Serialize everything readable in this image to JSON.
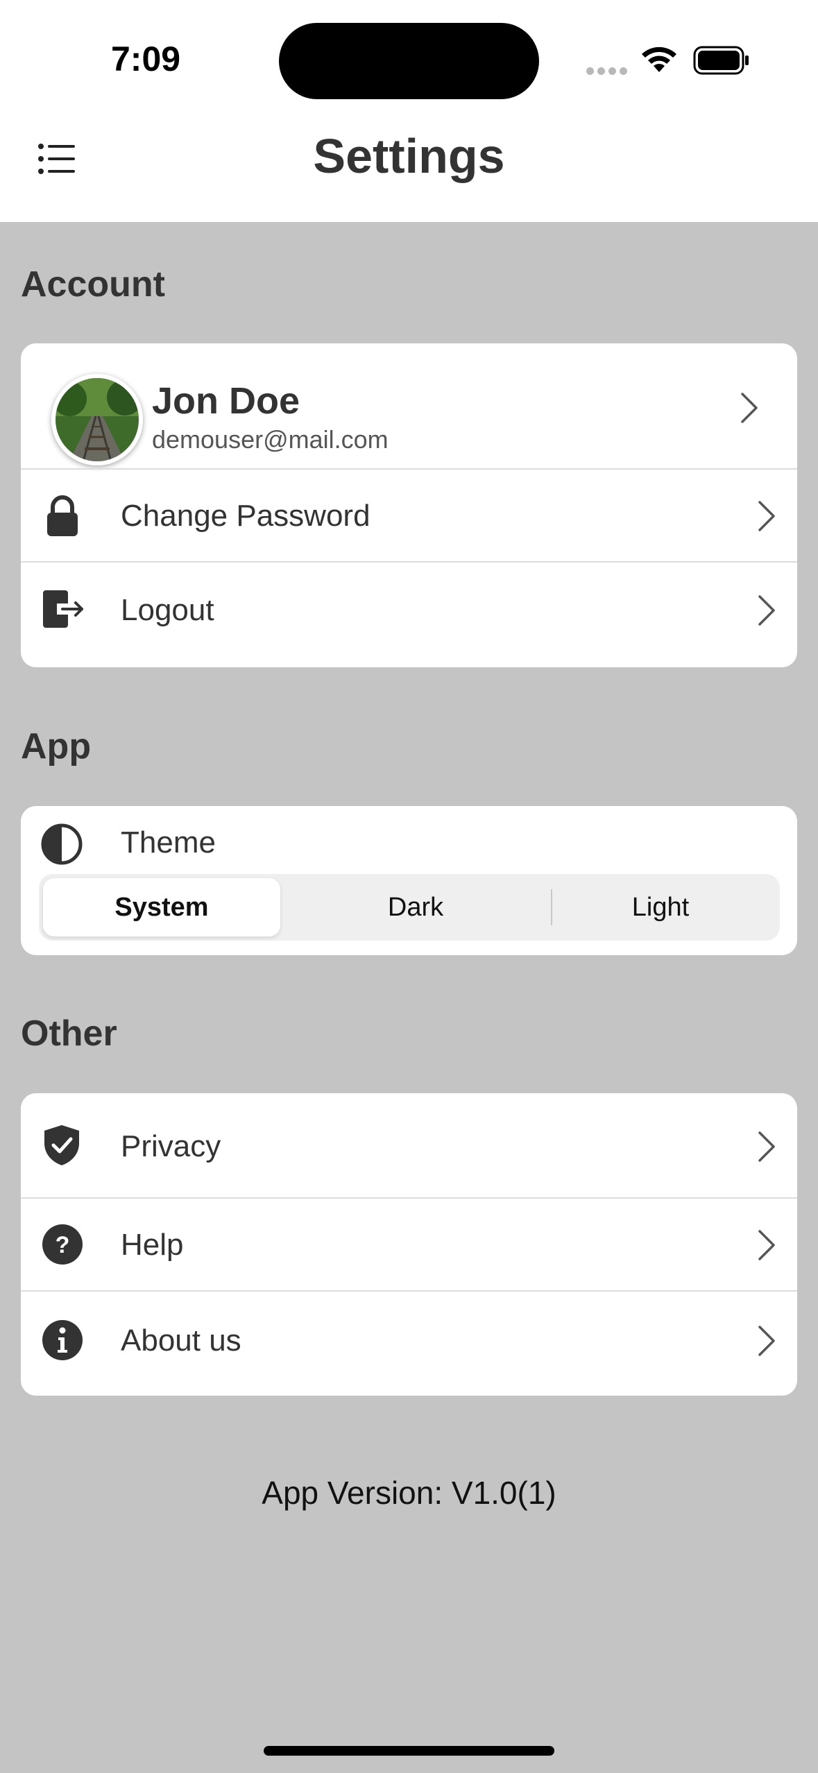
{
  "status_bar": {
    "time": "7:09"
  },
  "header": {
    "title": "Settings"
  },
  "account": {
    "section_title": "Account",
    "user": {
      "name": "Jon Doe",
      "email": "demouser@mail.com"
    },
    "items": [
      {
        "label": "Change Password",
        "icon": "lock-icon"
      },
      {
        "label": "Logout",
        "icon": "logout-icon"
      }
    ]
  },
  "app": {
    "section_title": "App",
    "theme": {
      "label": "Theme",
      "icon": "contrast-icon",
      "options": [
        "System",
        "Dark",
        "Light"
      ],
      "selected": "System"
    }
  },
  "other": {
    "section_title": "Other",
    "items": [
      {
        "label": "Privacy",
        "icon": "shield-check-icon"
      },
      {
        "label": "Help",
        "icon": "question-circle-icon"
      },
      {
        "label": "About us",
        "icon": "info-circle-icon"
      }
    ]
  },
  "footer": {
    "version": "App Version: V1.0(1)"
  },
  "colors": {
    "background": "#c4c4c4",
    "card": "#ffffff",
    "text": "#333333"
  }
}
